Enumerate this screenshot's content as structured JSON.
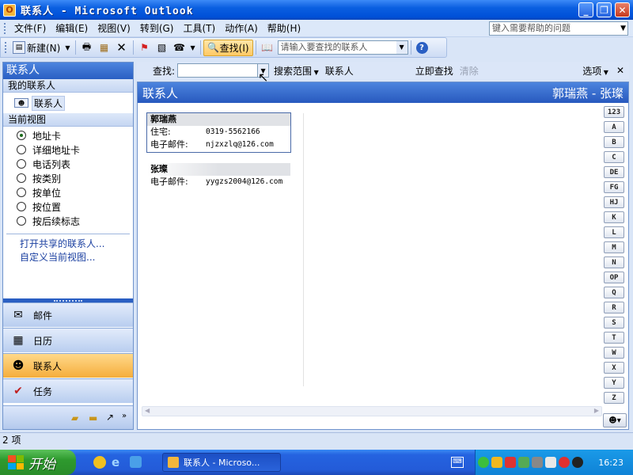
{
  "window": {
    "title": "联系人 - Microsoft Outlook"
  },
  "menu": {
    "items": [
      "文件(F)",
      "编辑(E)",
      "视图(V)",
      "转到(G)",
      "工具(T)",
      "动作(A)",
      "帮助(H)"
    ],
    "help_placeholder": "键入需要帮助的问题"
  },
  "toolbar": {
    "new_label": "新建(N)",
    "find_label": "查找(I)",
    "address_search_placeholder": "请输入要查找的联系人"
  },
  "nav": {
    "header": "联系人",
    "my_contacts_title": "我的联系人",
    "my_contacts_item": "联系人",
    "current_view_title": "当前视图",
    "views": [
      "地址卡",
      "详细地址卡",
      "电话列表",
      "按类别",
      "按单位",
      "按位置",
      "按后续标志"
    ],
    "selected_view": "地址卡",
    "links": [
      "打开共享的联系人...",
      "自定义当前视图..."
    ],
    "buttons": [
      "邮件",
      "日历",
      "联系人",
      "任务"
    ],
    "selected_button": "联系人"
  },
  "findbar": {
    "label": "查找:",
    "search_value": "",
    "scope_label": "搜索范围",
    "scope_value": "联系人",
    "find_now": "立即查找",
    "clear": "清除",
    "options": "选项"
  },
  "contacts": {
    "header_title": "联系人",
    "range": "郭瑞燕 - 张璨",
    "cards": [
      {
        "name": "郭瑞燕",
        "fields": [
          {
            "label": "住宅:",
            "value": "0319-5562166"
          },
          {
            "label": "电子邮件:",
            "value": "njzxzlq@126.com"
          }
        ]
      },
      {
        "name": "张璨",
        "fields": [
          {
            "label": "电子邮件:",
            "value": "yygzs2004@126.com"
          }
        ]
      }
    ],
    "alphabet": [
      "123",
      "A",
      "B",
      "C",
      "DE",
      "FG",
      "HJ",
      "K",
      "L",
      "M",
      "N",
      "OP",
      "Q",
      "R",
      "S",
      "T",
      "W",
      "X",
      "Y",
      "Z"
    ]
  },
  "status": {
    "count": "2 项"
  },
  "taskbar": {
    "start_label": "开始",
    "app_button": "联系人 - Microso...",
    "clock": "16:23"
  }
}
